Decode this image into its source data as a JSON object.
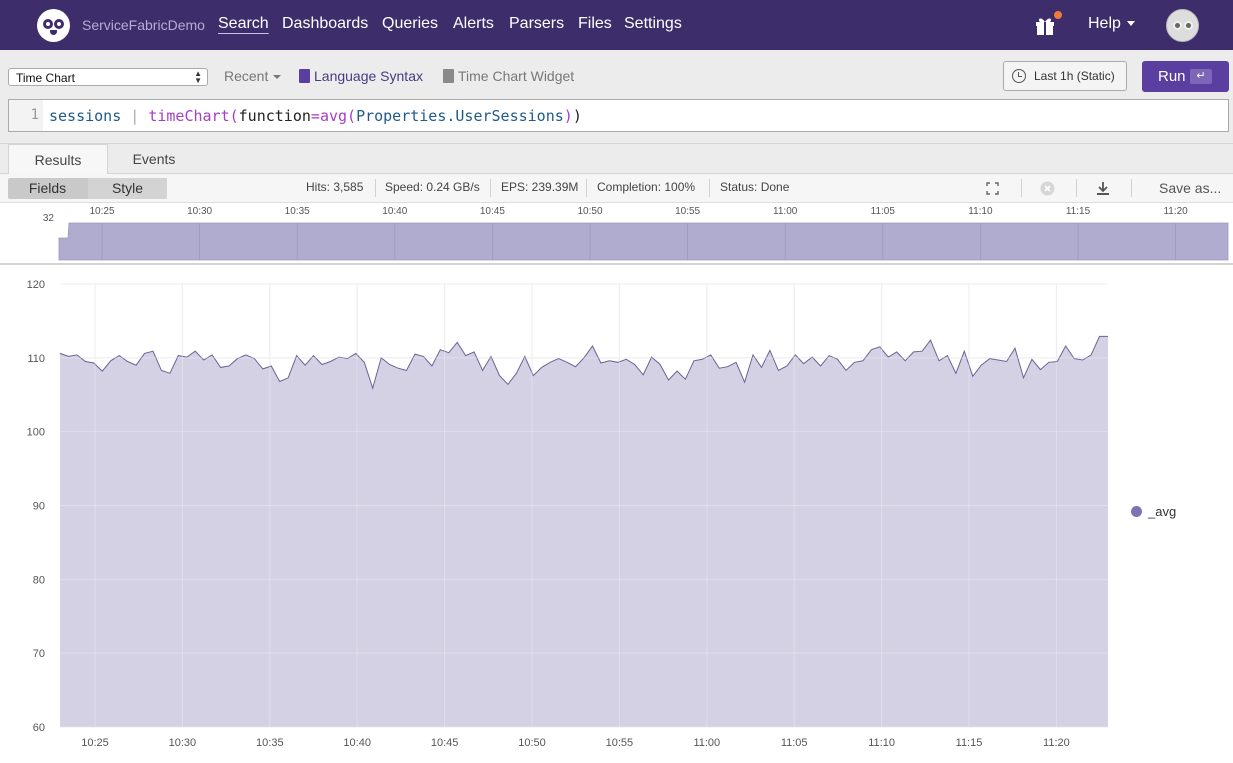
{
  "nav": {
    "brand": "ServiceFabricDemo",
    "items": [
      "Search",
      "Dashboards",
      "Queries",
      "Alerts",
      "Parsers",
      "Files",
      "Settings"
    ],
    "help_label": "Help"
  },
  "toolbar": {
    "widget_select": "Time Chart",
    "recent_label": "Recent",
    "language_syntax_label": "Language Syntax",
    "time_chart_widget_label": "Time Chart Widget",
    "time_range_label": "Last 1h (Static)",
    "run_label": "Run",
    "run_key": "↵"
  },
  "editor": {
    "line_number": "1",
    "query": {
      "part1": "sessions",
      "pipe": " | ",
      "fn": "timeChart(",
      "arg": "function",
      "eq": "=",
      "fn2": "avg(",
      "field": "Properties.UserSessions",
      "close1": ")",
      "close2": ")"
    }
  },
  "tabs": [
    "Results",
    "Events"
  ],
  "statsbar": {
    "fields_label": "Fields",
    "style_label": "Style",
    "hits": "Hits: 3,585",
    "speed": "Speed: 0.24 GB/s",
    "eps": "EPS: 239.39M",
    "completion": "Completion: 100%",
    "status": "Status: Done",
    "save_as_label": "Save as..."
  },
  "colors": {
    "nav_bg": "#3d2d6b",
    "run_button": "#5b3fa0",
    "series_fill": "#cdc9e0",
    "series_line": "#6b6395",
    "legend_dot": "#7f72b2"
  },
  "chart_data": {
    "type": "area",
    "series": [
      {
        "name": "_avg",
        "values": [
          110.6,
          110.2,
          110.4,
          109.5,
          109.3,
          108.2,
          109.6,
          110.3,
          109.5,
          109.0,
          110.6,
          110.9,
          108.3,
          107.9,
          110.3,
          110.1,
          110.9,
          109.7,
          110.4,
          108.7,
          108.9,
          109.9,
          110.4,
          109.9,
          108.5,
          108.9,
          106.8,
          107.3,
          110.3,
          109.0,
          110.3,
          109.1,
          109.5,
          110.1,
          109.9,
          110.6,
          109.4,
          105.9,
          110.0,
          109.1,
          108.6,
          108.3,
          110.5,
          110.2,
          108.9,
          111.1,
          110.7,
          112.1,
          110.3,
          110.8,
          108.3,
          110.2,
          107.6,
          106.4,
          107.9,
          110.2,
          107.6,
          108.7,
          109.4,
          109.9,
          109.4,
          108.8,
          110.0,
          111.6,
          109.3,
          109.6,
          109.4,
          109.8,
          109.1,
          107.7,
          110.1,
          109.1,
          107.0,
          108.2,
          107.1,
          109.6,
          109.8,
          110.4,
          108.6,
          108.8,
          109.4,
          106.7,
          110.4,
          108.7,
          111.0,
          108.3,
          108.9,
          110.4,
          109.2,
          110.1,
          108.9,
          110.3,
          109.8,
          108.3,
          109.4,
          109.6,
          111.1,
          111.5,
          110.1,
          110.8,
          109.6,
          110.8,
          110.9,
          112.4,
          109.6,
          110.3,
          107.9,
          110.9,
          107.5,
          109.0,
          109.9,
          109.7,
          109.5,
          111.3,
          107.3,
          109.8,
          108.4,
          109.4,
          109.5,
          111.6,
          109.9,
          109.7,
          110.4,
          112.9,
          112.9
        ]
      }
    ],
    "x_ticks": [
      "10:25",
      "10:30",
      "10:35",
      "10:40",
      "10:45",
      "10:50",
      "10:55",
      "11:00",
      "11:05",
      "11:10",
      "11:15",
      "11:20"
    ],
    "y_ticks": [
      60,
      70,
      80,
      90,
      100,
      110,
      120
    ],
    "ylim": [
      60,
      120
    ],
    "overview_max": "32",
    "overview_ticks": [
      "10:25",
      "10:30",
      "10:35",
      "10:40",
      "10:45",
      "10:50",
      "10:55",
      "11:00",
      "11:05",
      "11:10",
      "11:15",
      "11:20"
    ],
    "grid": true,
    "legend_position": "right"
  }
}
